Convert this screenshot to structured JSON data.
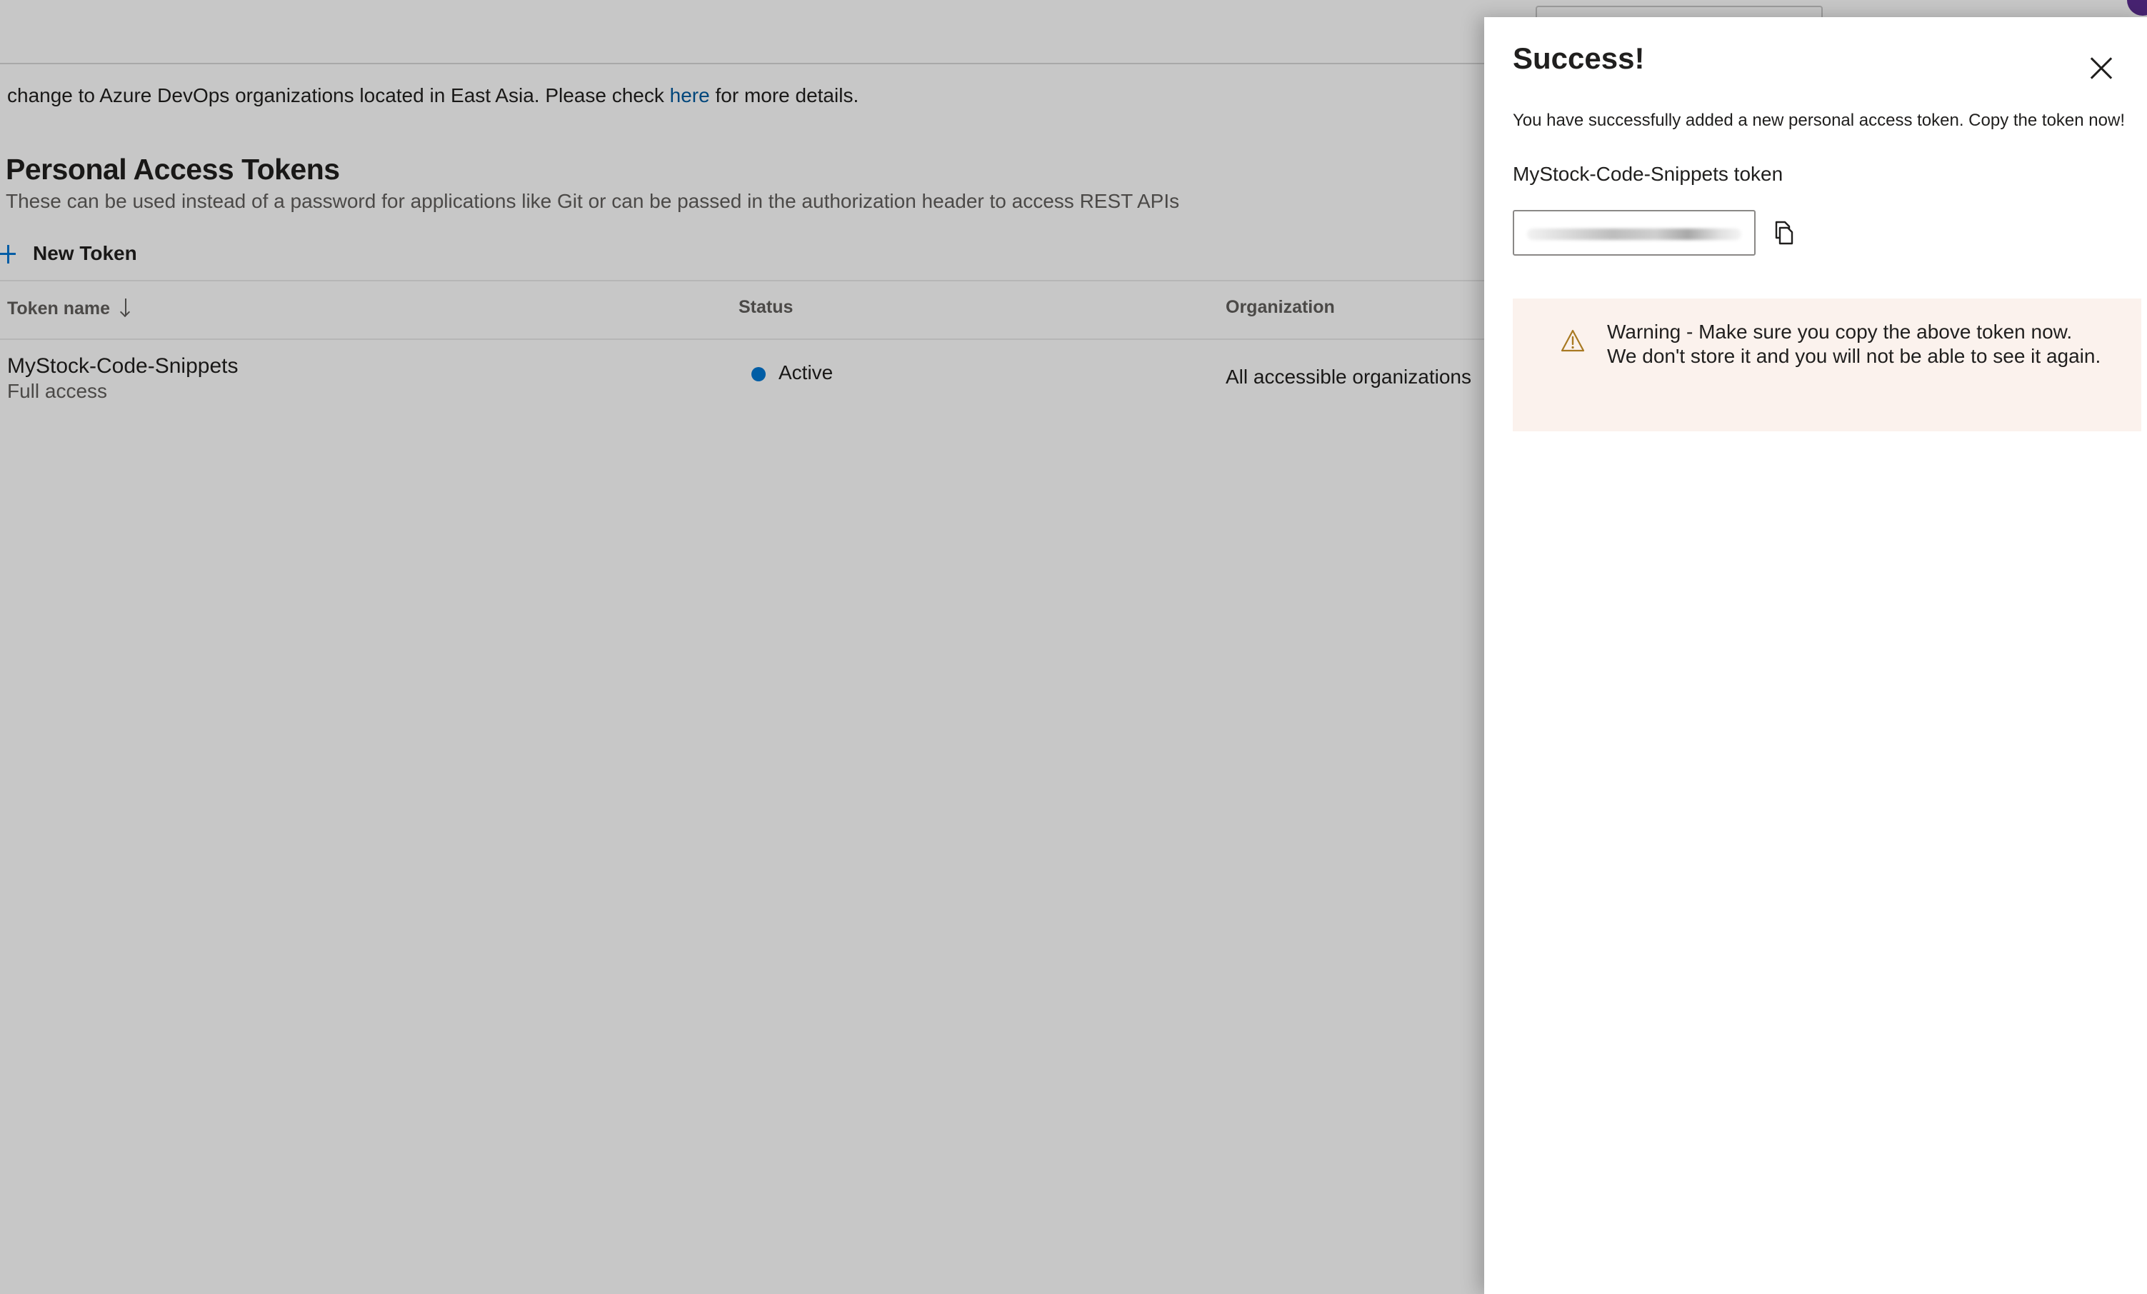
{
  "notice": {
    "text_before": "change to Azure DevOps organizations located in East Asia. Please check ",
    "link": "here",
    "text_after": " for more details."
  },
  "pat": {
    "title": "Personal Access Tokens",
    "subtitle": "These can be used instead of a password for applications like Git or can be passed in the authorization header to access REST APIs",
    "new_token_label": "New Token"
  },
  "table": {
    "headers": {
      "name": "Token name",
      "status": "Status",
      "organization": "Organization"
    },
    "rows": [
      {
        "name": "MyStock-Code-Snippets",
        "scope": "Full access",
        "status": "Active",
        "organization": "All accessible organizations"
      }
    ]
  },
  "panel": {
    "title": "Success!",
    "message": "You have successfully added a new personal access token. Copy the token now!",
    "token_label": "MyStock-Code-Snippets token",
    "warning": "Warning - Make sure you copy the above token now. We don't store it and you will not be able to see it again."
  },
  "colors": {
    "accent": "#0078d4",
    "link": "#005a9e",
    "warning_bg": "#fbf2ed",
    "warning_icon": "#a87922"
  },
  "icons": {
    "add": "plus-icon",
    "sort": "arrow-down-icon",
    "close": "close-icon",
    "copy": "copy-icon",
    "warning": "warning-icon"
  }
}
